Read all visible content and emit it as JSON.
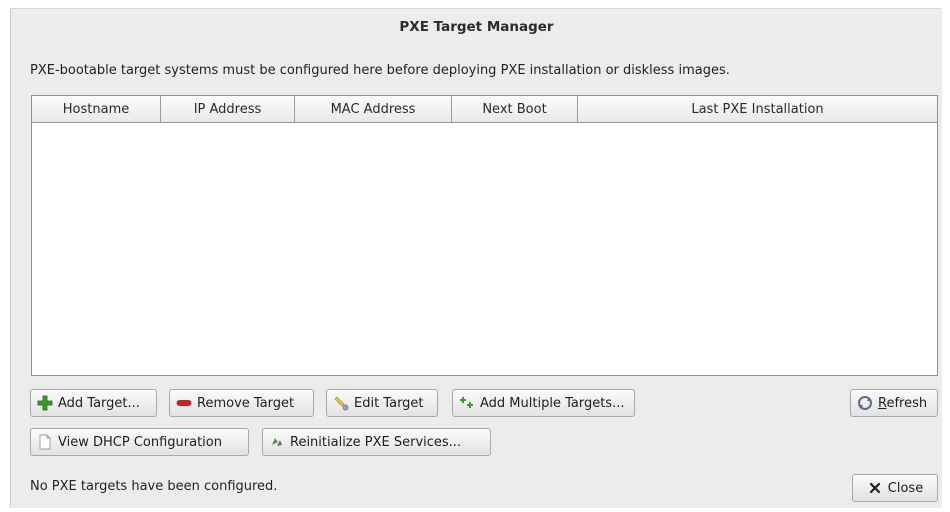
{
  "window": {
    "title": "PXE Target Manager"
  },
  "description": "PXE-bootable target systems must be configured here before deploying PXE installation or diskless images.",
  "table": {
    "columns": [
      "Hostname",
      "IP Address",
      "MAC Address",
      "Next Boot",
      "Last PXE Installation"
    ],
    "rows": []
  },
  "buttons": {
    "add_target": "Add Target...",
    "remove_target": "Remove Target",
    "edit_target": "Edit Target",
    "add_multiple": "Add Multiple Targets...",
    "refresh_mnemonic": "R",
    "refresh_rest": "efresh",
    "view_dhcp": "View DHCP Configuration",
    "reinitialize": "Reinitialize PXE Services...",
    "close": "Close"
  },
  "status": "No PXE targets have been configured.",
  "icons": {
    "add": "plus-icon",
    "remove": "minus-icon",
    "edit": "wrench-icon",
    "add_multiple": "sparkle-plus-icon",
    "refresh": "refresh-icon",
    "view_dhcp": "document-icon",
    "reinitialize": "recycle-icon",
    "close": "close-icon"
  },
  "colors": {
    "add_green": "#3a9a2a",
    "remove_red": "#cc1f2a",
    "window_bg": "#ececec"
  }
}
